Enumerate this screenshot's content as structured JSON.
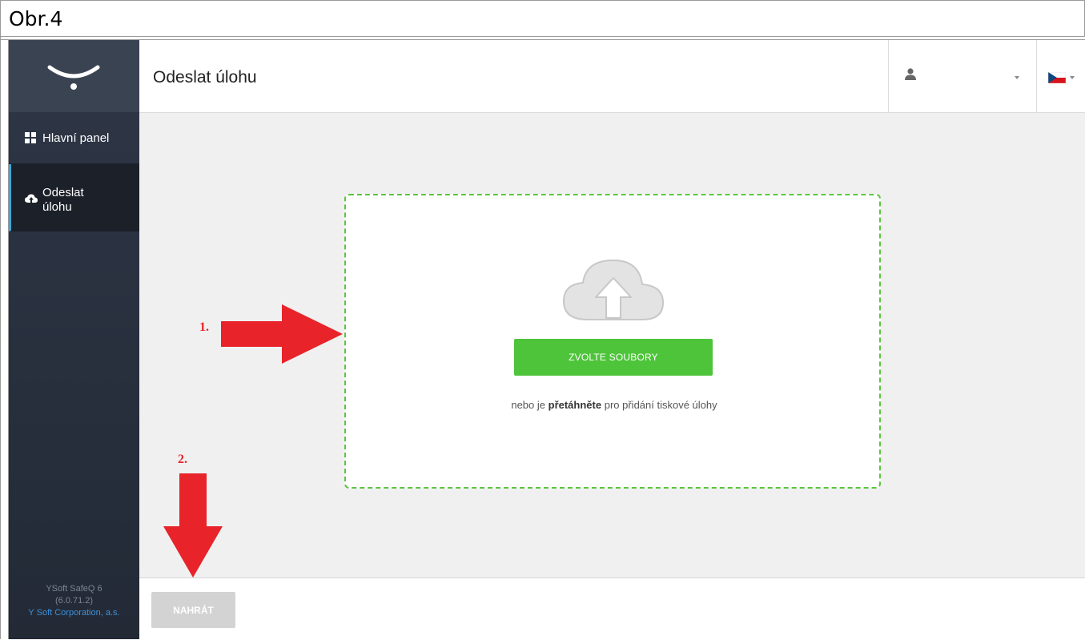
{
  "caption": {
    "text": "Obr.4"
  },
  "sidebar": {
    "logo_icon": "safeq-logo-icon",
    "items": [
      {
        "label": "Hlavní panel",
        "icon": "grid-icon"
      },
      {
        "label": "Odeslat úlohu",
        "icon": "cloud-upload-icon",
        "active": true
      }
    ],
    "footer": {
      "product": "YSoft SafeQ 6",
      "version": "(6.0.71.2)",
      "company": "Y Soft Corporation, a.s."
    }
  },
  "header": {
    "title": "Odeslat úlohu",
    "user_icon": "user-icon",
    "language": "Czech flag"
  },
  "dropzone": {
    "icon": "cloud-upload-icon",
    "choose_button": "ZVOLTE SOUBORY",
    "hint_prefix": "nebo je",
    "hint_bold": "přetáhněte",
    "hint_suffix": "pro přidání tiskové úlohy"
  },
  "footer": {
    "upload_button": "NAHRÁT"
  },
  "annotations": {
    "step1": "1.",
    "step2": "2.",
    "color": "#e8232a"
  },
  "colors": {
    "sidebar": "#2f3747",
    "accent": "#3da7d8",
    "green": "#4ec43a",
    "dropzone_border": "#5cc540"
  }
}
